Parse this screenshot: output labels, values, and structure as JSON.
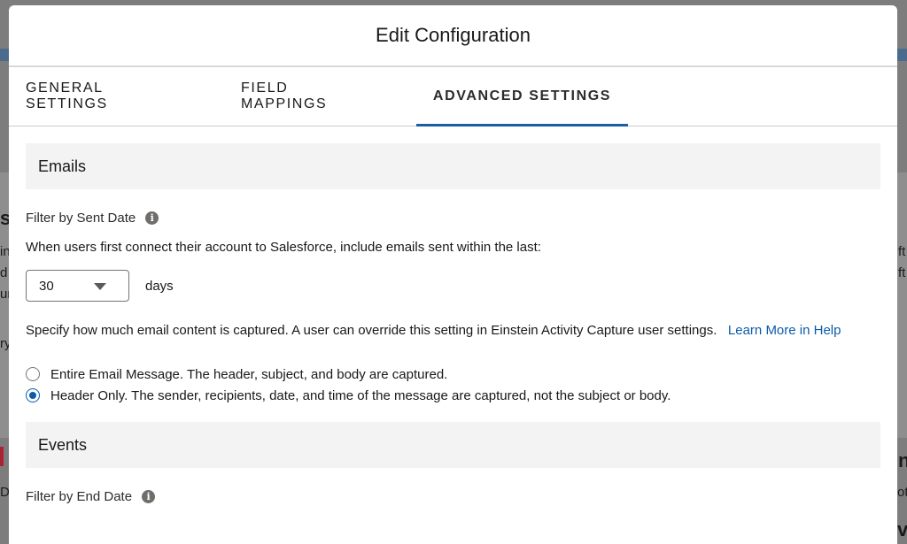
{
  "background": {
    "fragments": [
      "s",
      "in",
      "d",
      "ur",
      "ry",
      "ft",
      "ft",
      "n",
      "oti",
      "ve",
      "D"
    ]
  },
  "modal": {
    "title": "Edit Configuration"
  },
  "tabs": [
    {
      "label": "GENERAL SETTINGS",
      "active": false
    },
    {
      "label": "FIELD MAPPINGS",
      "active": false
    },
    {
      "label": "ADVANCED SETTINGS",
      "active": true
    }
  ],
  "emails": {
    "section_title": "Emails",
    "filter_label": "Filter by Sent Date",
    "filter_description": "When users first connect their account to Salesforce, include emails sent within the last:",
    "days_value": "30",
    "days_unit": "days",
    "content_description": "Specify how much email content is captured. A user can override this setting in Einstein Activity Capture user settings.",
    "learn_more_link": "Learn More in Help",
    "options": [
      {
        "label": "Entire Email Message. The header, subject, and body are captured.",
        "selected": false
      },
      {
        "label": "Header Only. The sender, recipients, date, and time of the message are captured, not the subject or body.",
        "selected": true
      }
    ]
  },
  "events": {
    "section_title": "Events",
    "filter_label": "Filter by End Date"
  },
  "colors": {
    "accent": "#1b5ea8",
    "link": "#0b5cab",
    "section_bg": "#f3f3f3"
  }
}
